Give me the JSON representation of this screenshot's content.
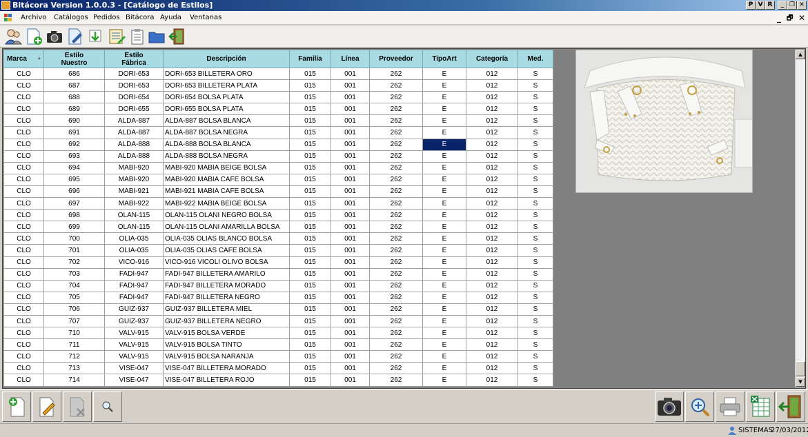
{
  "window": {
    "title": "Bitácora Version 1.0.0.3 - [Catálogo de Estilos]",
    "buttons": [
      "P",
      "V",
      "R",
      "_",
      "❐",
      "✕"
    ]
  },
  "menu": {
    "items": [
      "Archivo",
      "Catálogos",
      "Pedidos",
      "Bitácora",
      "Ayuda",
      "Ventanas"
    ],
    "mdi_controls": [
      "_",
      "🗗",
      "✕"
    ]
  },
  "toolbar": {
    "icons": [
      "users-icon",
      "new-document-icon",
      "camera-icon",
      "edit-document-icon",
      "download-icon",
      "notes-icon",
      "clipboard-icon",
      "folder-icon",
      "exit-icon"
    ]
  },
  "grid": {
    "columns": [
      {
        "label": "Marca",
        "sort": "▲"
      },
      {
        "label": "Estilo Nuestro"
      },
      {
        "label": "Estilo Fábrica"
      },
      {
        "label": "Descripción"
      },
      {
        "label": "Familia"
      },
      {
        "label": "Línea"
      },
      {
        "label": "Proveedor"
      },
      {
        "label": "TipoArt"
      },
      {
        "label": "Categoría"
      },
      {
        "label": "Med."
      }
    ],
    "selected_row": 6,
    "selected_col": 7,
    "rows": [
      [
        "CLO",
        "686",
        "DORI-653",
        "DORI-653 BILLETERA ORO",
        "015",
        "001",
        "262",
        "E",
        "012",
        "S"
      ],
      [
        "CLO",
        "687",
        "DORI-653",
        "DORI-653 BILLETERA PLATA",
        "015",
        "001",
        "262",
        "E",
        "012",
        "S"
      ],
      [
        "CLO",
        "688",
        "DORI-654",
        "DORI-654 BOLSA PLATA",
        "015",
        "001",
        "262",
        "E",
        "012",
        "S"
      ],
      [
        "CLO",
        "689",
        "DORI-655",
        "DORI-655 BOLSA PLATA",
        "015",
        "001",
        "262",
        "E",
        "012",
        "S"
      ],
      [
        "CLO",
        "690",
        "ALDA-887",
        "ALDA-887 BOLSA BLANCA",
        "015",
        "001",
        "262",
        "E",
        "012",
        "S"
      ],
      [
        "CLO",
        "691",
        "ALDA-887",
        "ALDA-887 BOLSA NEGRA",
        "015",
        "001",
        "262",
        "E",
        "012",
        "S"
      ],
      [
        "CLO",
        "692",
        "ALDA-888",
        "ALDA-888 BOLSA BLANCA",
        "015",
        "001",
        "262",
        "E",
        "012",
        "S"
      ],
      [
        "CLO",
        "693",
        "ALDA-888",
        "ALDA-888 BOLSA NEGRA",
        "015",
        "001",
        "262",
        "E",
        "012",
        "S"
      ],
      [
        "CLO",
        "694",
        "MABI-920",
        "MABI-920 MABIA BEIGE BOLSA",
        "015",
        "001",
        "262",
        "E",
        "012",
        "S"
      ],
      [
        "CLO",
        "695",
        "MABI-920",
        "MABI-920 MABIA CAFE BOLSA",
        "015",
        "001",
        "262",
        "E",
        "012",
        "S"
      ],
      [
        "CLO",
        "696",
        "MABI-921",
        "MABI-921 MABIA CAFE BOLSA",
        "015",
        "001",
        "262",
        "E",
        "012",
        "S"
      ],
      [
        "CLO",
        "697",
        "MABI-922",
        "MABI-922 MABIA BEIGE BOLSA",
        "015",
        "001",
        "262",
        "E",
        "012",
        "S"
      ],
      [
        "CLO",
        "698",
        "OLAN-115",
        "OLAN-115 OLANI NEGRO BOLSA",
        "015",
        "001",
        "262",
        "E",
        "012",
        "S"
      ],
      [
        "CLO",
        "699",
        "OLAN-115",
        "OLAN-115 OLANI AMARILLA BOLSA",
        "015",
        "001",
        "262",
        "E",
        "012",
        "S"
      ],
      [
        "CLO",
        "700",
        "OLIA-035",
        "OLIA-035 OLIAS BLANCO BOLSA",
        "015",
        "001",
        "262",
        "E",
        "012",
        "S"
      ],
      [
        "CLO",
        "701",
        "OLIA-035",
        "OLIA-035 OLIAS CAFE BOLSA",
        "015",
        "001",
        "262",
        "E",
        "012",
        "S"
      ],
      [
        "CLO",
        "702",
        "VICO-916",
        "VICO-916 VICOLI OLIVO BOLSA",
        "015",
        "001",
        "262",
        "E",
        "012",
        "S"
      ],
      [
        "CLO",
        "703",
        "FADI-947",
        "FADI-947 BILLETERA AMARILO",
        "015",
        "001",
        "262",
        "E",
        "012",
        "S"
      ],
      [
        "CLO",
        "704",
        "FADI-947",
        "FADI-947 BILLETERA MORADO",
        "015",
        "001",
        "262",
        "E",
        "012",
        "S"
      ],
      [
        "CLO",
        "705",
        "FADI-947",
        "FADI-947 BILLETERA NEGRO",
        "015",
        "001",
        "262",
        "E",
        "012",
        "S"
      ],
      [
        "CLO",
        "706",
        "GUIZ-937",
        "GUIZ-937 BILLETERA MIEL",
        "015",
        "001",
        "262",
        "E",
        "012",
        "S"
      ],
      [
        "CLO",
        "707",
        "GUIZ-937",
        "GUIZ-937 BILLETERA NEGRO",
        "015",
        "001",
        "262",
        "E",
        "012",
        "S"
      ],
      [
        "CLO",
        "710",
        "VALV-915",
        "VALV-915 BOLSA VERDE",
        "015",
        "001",
        "262",
        "E",
        "012",
        "S"
      ],
      [
        "CLO",
        "711",
        "VALV-915",
        "VALV-915 BOLSA TINTO",
        "015",
        "001",
        "262",
        "E",
        "012",
        "S"
      ],
      [
        "CLO",
        "712",
        "VALV-915",
        "VALV-915 BOLSA NARANJA",
        "015",
        "001",
        "262",
        "E",
        "012",
        "S"
      ],
      [
        "CLO",
        "713",
        "VISE-047",
        "VISE-047 BILLETERA MORADO",
        "015",
        "001",
        "262",
        "E",
        "012",
        "S"
      ],
      [
        "CLO",
        "714",
        "VISE-047",
        "VISE-047 BILLETERA ROJO",
        "015",
        "001",
        "262",
        "E",
        "012",
        "S"
      ]
    ]
  },
  "bottom_left_buttons": [
    "add-document-icon",
    "edit-icon",
    "delete-document-icon",
    "search-icon"
  ],
  "bottom_right_buttons": [
    "camera-icon",
    "zoom-icon",
    "printer-icon",
    "excel-icon",
    "exit-icon"
  ],
  "status": {
    "user": "SISTEMAS",
    "date": "27/03/2012"
  }
}
